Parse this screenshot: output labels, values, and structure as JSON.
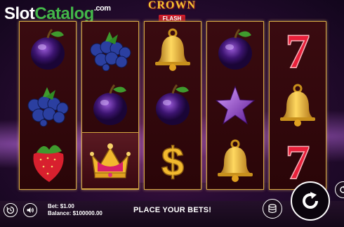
{
  "watermark": {
    "part1": "Slot",
    "part2": "Catalog",
    "part3": ".com"
  },
  "logo": {
    "title": "CROWN",
    "subtitle": "FLASH"
  },
  "reels": [
    [
      "plum",
      "blueberries",
      "strawberry"
    ],
    [
      "blueberries",
      "plum",
      "crown"
    ],
    [
      "bell",
      "plum",
      "dollar"
    ],
    [
      "plum",
      "star",
      "bell"
    ],
    [
      "seven",
      "bell",
      "seven"
    ]
  ],
  "footer": {
    "bet_label": "Bet: $1.00",
    "balance_label": "Balance: $100000.00",
    "message": "PLACE YOUR BETS!"
  },
  "icons": {
    "history": "history-icon",
    "sound": "speaker-icon",
    "bet": "coins-icon",
    "spin": "spin-icon",
    "autoplay": "autoplay-icon"
  },
  "colors": {
    "watermark_green": "#43b649",
    "reel_border": "#d4a640",
    "logo_gold": "#f4c430"
  }
}
